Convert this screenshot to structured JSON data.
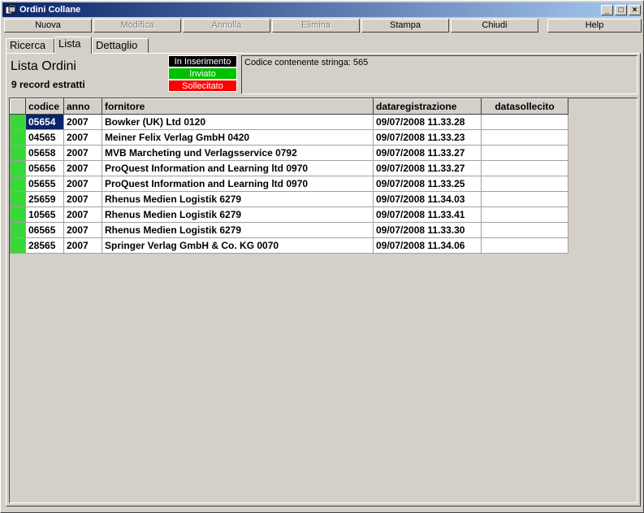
{
  "window": {
    "title": "Ordini Collane"
  },
  "titlebar_buttons": {
    "minimize": "_",
    "maximize": "□",
    "close": "×"
  },
  "toolbar": {
    "nuova": "Nuova",
    "modifica": "Modifica",
    "annulla": "Annulla",
    "elimina": "Elimina",
    "stampa": "Stampa",
    "chiudi": "Chiudi",
    "help": "Help"
  },
  "tabs": [
    {
      "label": "Ricerca"
    },
    {
      "label": "Lista"
    },
    {
      "label": "Dettaglio"
    }
  ],
  "main": {
    "heading": "Lista Ordini",
    "record_count": "9 record estratti",
    "filter_text": "Codice contenente stringa: 565"
  },
  "legend": [
    {
      "label": "In Inserimento",
      "color": "#000000"
    },
    {
      "label": "Inviato",
      "color": "#00c000"
    },
    {
      "label": "Sollecitato",
      "color": "#ff0000"
    }
  ],
  "table": {
    "columns": [
      "codice",
      "anno",
      "fornitore",
      "dataregistrazione",
      "datasollecito"
    ],
    "rows": [
      {
        "codice": "05654",
        "anno": "2007",
        "fornitore": "Bowker (UK) Ltd 0120",
        "dataregistrazione": "09/07/2008 11.33.28",
        "datasollecito": ""
      },
      {
        "codice": "04565",
        "anno": "2007",
        "fornitore": "Meiner Felix Verlag GmbH 0420",
        "dataregistrazione": "09/07/2008 11.33.23",
        "datasollecito": ""
      },
      {
        "codice": "05658",
        "anno": "2007",
        "fornitore": "MVB Marcheting und Verlagsservice 0792",
        "dataregistrazione": "09/07/2008 11.33.27",
        "datasollecito": ""
      },
      {
        "codice": "05656",
        "anno": "2007",
        "fornitore": "ProQuest Information and Learning ltd 0970",
        "dataregistrazione": "09/07/2008 11.33.27",
        "datasollecito": ""
      },
      {
        "codice": "05655",
        "anno": "2007",
        "fornitore": "ProQuest Information and Learning ltd 0970",
        "dataregistrazione": "09/07/2008 11.33.25",
        "datasollecito": ""
      },
      {
        "codice": "25659",
        "anno": "2007",
        "fornitore": "Rhenus Medien Logistik 6279",
        "dataregistrazione": "09/07/2008 11.34.03",
        "datasollecito": ""
      },
      {
        "codice": "10565",
        "anno": "2007",
        "fornitore": "Rhenus Medien Logistik 6279",
        "dataregistrazione": "09/07/2008 11.33.41",
        "datasollecito": ""
      },
      {
        "codice": "06565",
        "anno": "2007",
        "fornitore": "Rhenus Medien Logistik 6279",
        "dataregistrazione": "09/07/2008 11.33.30",
        "datasollecito": ""
      },
      {
        "codice": "28565",
        "anno": "2007",
        "fornitore": "Springer Verlag GmbH & Co. KG 0070",
        "dataregistrazione": "09/07/2008 11.34.06",
        "datasollecito": ""
      }
    ],
    "status_color": "#38d838"
  }
}
